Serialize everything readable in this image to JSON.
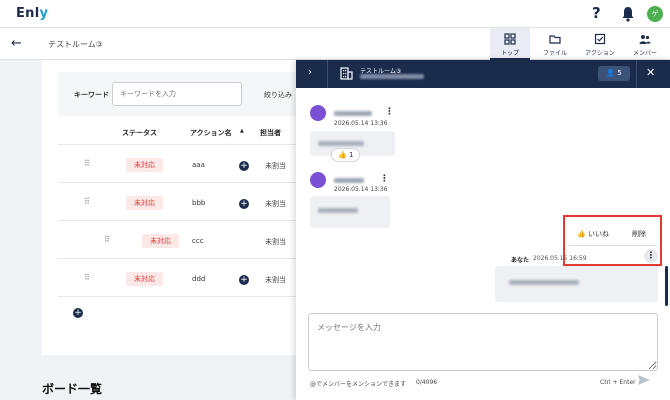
{
  "app": {
    "logo_main": "Enl",
    "logo_accent": "y",
    "avatar_initial": "ゲ"
  },
  "header": {
    "room_title": "テストルーム③",
    "tabs": [
      {
        "label": "トップ",
        "icon": "grid-icon",
        "active": true
      },
      {
        "label": "ファイル",
        "icon": "folder-icon",
        "active": false
      },
      {
        "label": "アクション",
        "icon": "checkbox-icon",
        "active": false
      },
      {
        "label": "メンバー",
        "icon": "people-icon",
        "active": false
      }
    ]
  },
  "filters": {
    "keyword_label": "キーワード",
    "keyword_placeholder": "キーワードを入力",
    "filter_label": "絞り込み"
  },
  "table": {
    "columns": [
      "ステータス",
      "アクション名",
      "担当者"
    ],
    "sort_indicator": "▲",
    "rows": [
      {
        "status": "未対応",
        "action": "aaa",
        "assignee": "未割当"
      },
      {
        "status": "未対応",
        "action": "bbb",
        "assignee": "未割当"
      },
      {
        "status": "未対応",
        "action": "ccc",
        "assignee": "未割当"
      },
      {
        "status": "未対応",
        "action": "ddd",
        "assignee": "未割当"
      }
    ]
  },
  "board": {
    "title": "ボード一覧"
  },
  "chat": {
    "room_name": "テストルーム③",
    "member_count": "5",
    "messages": [
      {
        "time": "2026.05.14 13:36",
        "likes": "1"
      },
      {
        "time": "2026.05.14 13:36"
      }
    ],
    "context_menu": {
      "like_label": "いいね",
      "delete_label": "削除"
    },
    "own_message": {
      "author": "あなた",
      "time": "2026.05.15 16:59"
    },
    "input_placeholder": "メッセージを入力",
    "mention_hint": "@でメンバーをメンションできます",
    "char_count": "0/4096",
    "send_hint": "Ctrl + Enter"
  },
  "colors": {
    "navy": "#1a2b4c",
    "status_red": "#e53935",
    "status_bg": "#fde8e8",
    "avatar_green": "#4caf50",
    "msg_avatar_purple": "#7b4fd6"
  }
}
